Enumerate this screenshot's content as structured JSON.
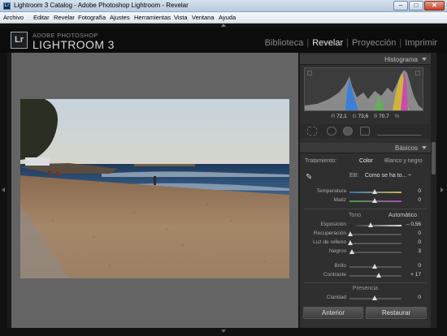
{
  "window": {
    "title": "Lightroom 3 Catalog - Adobe Photoshop Lightroom - Revelar",
    "app_icon": "Lr"
  },
  "menu": [
    "Archivo",
    "Editar",
    "Revelar",
    "Fotografía",
    "Ajustes",
    "Herramientas",
    "Vista",
    "Ventana",
    "Ayuda"
  ],
  "header": {
    "logo": "Lr",
    "brand_small": "ADOBE PHOTOSHOP",
    "brand_big": "LIGHTROOM 3",
    "modules": [
      "Biblioteca",
      "Revelar",
      "Proyección",
      "Imprimir"
    ],
    "active_module": "Revelar"
  },
  "histogram": {
    "title": "Histograma",
    "r_label": "R",
    "r_value": "72,1",
    "g_label": "G",
    "g_value": "73,6",
    "b_label": "B",
    "b_value": "70,7",
    "unit": "%"
  },
  "basic": {
    "title": "Básicos",
    "treatment_label": "Tratamiento:",
    "treatment_color": "Color",
    "treatment_bw": "Blanco y negro",
    "wb_label": "EB:",
    "wb_value": "Como se ha to... ÷",
    "temperature_label": "Temperatura",
    "temperature_value": "0",
    "tint_label": "Matiz",
    "tint_value": "0",
    "tone_title": "Tono",
    "auto_label": "Automático",
    "exposure_label": "Exposición",
    "exposure_value": "– 0,56",
    "recovery_label": "Recuperación",
    "recovery_value": "0",
    "fill_label": "Luz de relleno",
    "fill_value": "0",
    "blacks_label": "Negros",
    "blacks_value": "3",
    "brightness_label": "Brillo",
    "brightness_value": "0",
    "contrast_label": "Contraste",
    "contrast_value": "+ 17",
    "presence_title": "Presencia",
    "clarity_label": "Claridad",
    "clarity_value": "0"
  },
  "buttons": {
    "previous": "Anterior",
    "reset": "Restaurar"
  }
}
